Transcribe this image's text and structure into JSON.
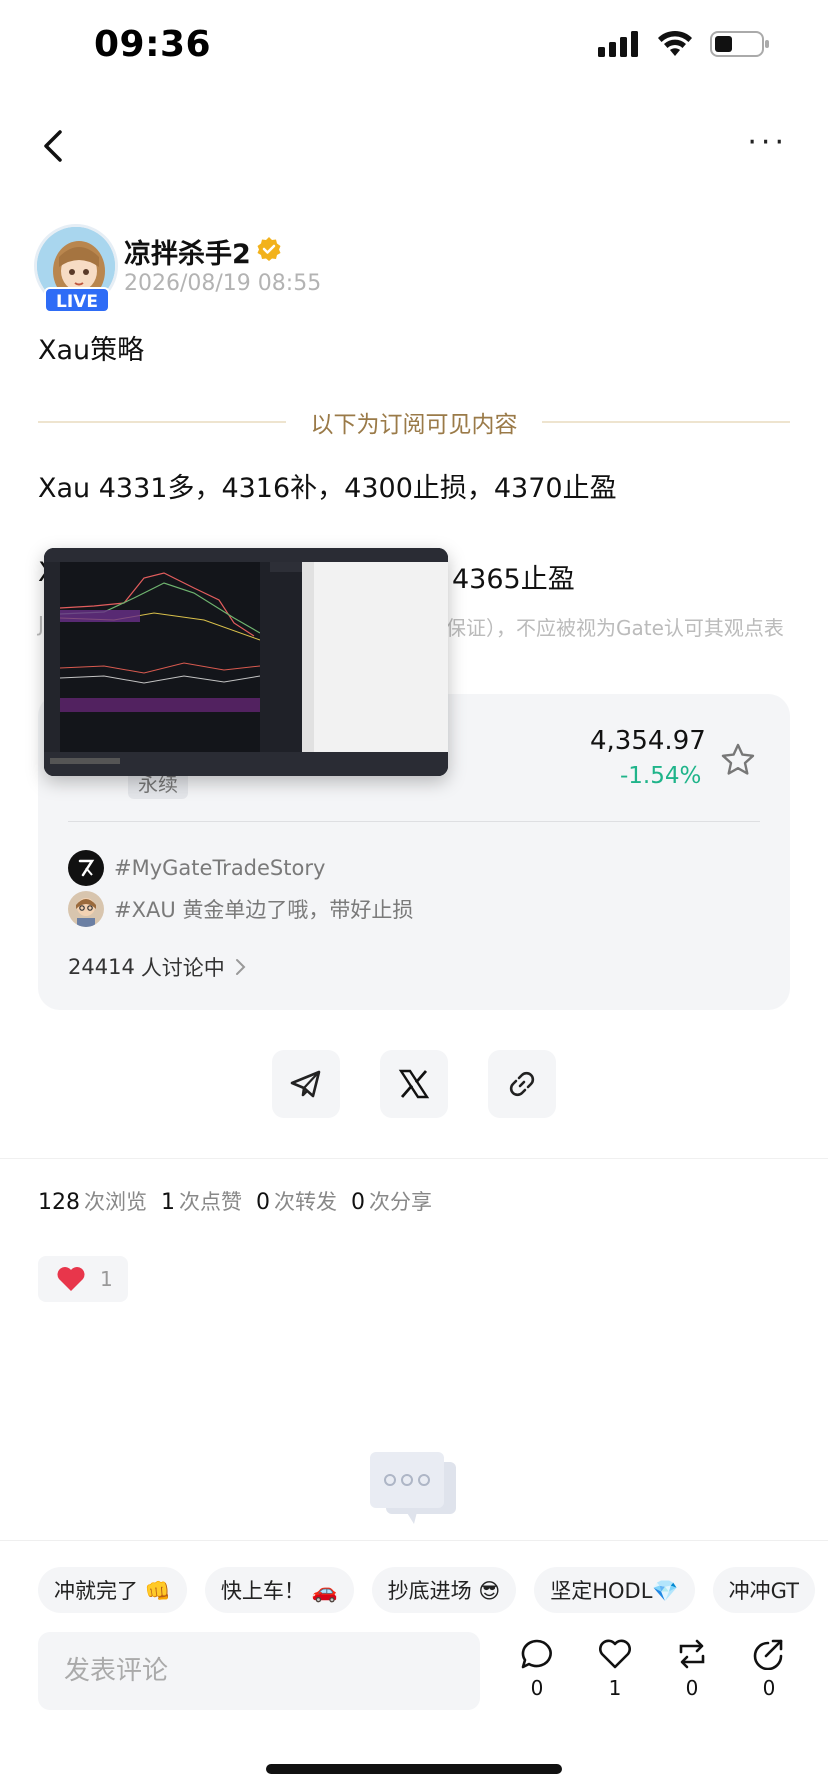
{
  "status_bar": {
    "time": "09:36"
  },
  "nav": {
    "more_label": "···"
  },
  "author": {
    "name": "凉拌杀手2",
    "timestamp": "2026/08/19 08:55",
    "live_badge": "LIVE"
  },
  "post": {
    "title": "Xau策略",
    "divider_text": "以下为订阅可见内容",
    "line1": "Xau 4331多，4316补，4300止损，4370止盈",
    "line2_start": "X",
    "line2_end": "4365止盈",
    "disclaimer": "保证），不应被视为Gate认可其观点表",
    "disclaimer_left": "J"
  },
  "asset_card": {
    "price": "4,354.97",
    "change": "-1.54%",
    "sub_label": "永续",
    "tags": [
      {
        "text": "#MyGateTradeStory"
      },
      {
        "text": "#XAU 黄金单边了哦，带好止损"
      }
    ],
    "discuss_count": "24414",
    "discuss_label": "人讨论中"
  },
  "stats": [
    {
      "value": "128",
      "label": "次浏览"
    },
    {
      "value": "1",
      "label": "次点赞"
    },
    {
      "value": "0",
      "label": "次转发"
    },
    {
      "value": "0",
      "label": "次分享"
    }
  ],
  "reactions": {
    "heart_count": "1"
  },
  "quick_replies": [
    "冲就完了 👊",
    "快上车！ 🚗",
    "抄底进场 😎",
    "坚定HODL💎",
    "冲冲GT"
  ],
  "comment": {
    "placeholder": "发表评论"
  },
  "actions": {
    "comment_count": "0",
    "like_count": "1",
    "repost_count": "0",
    "share_count": "0"
  },
  "colors": {
    "accent_gold": "#9a7a48",
    "negative": "#1fb48a",
    "live_blue": "#2e6cf6",
    "heart": "#e8364b"
  }
}
